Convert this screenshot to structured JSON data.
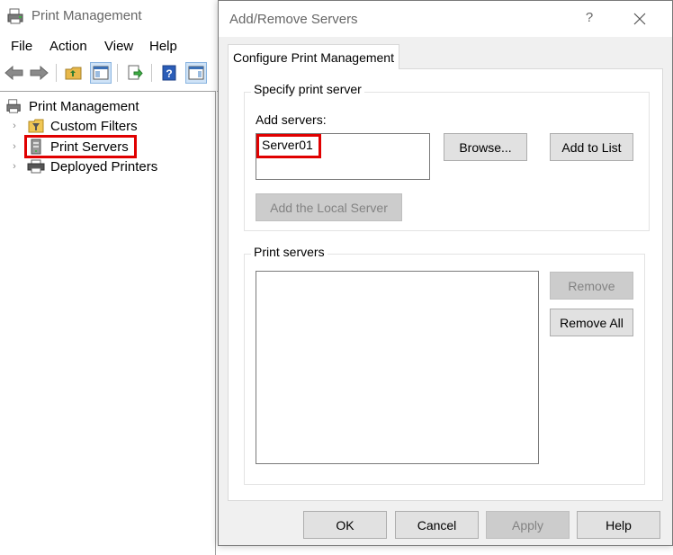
{
  "mmc": {
    "title": "Print Management",
    "menu": [
      "File",
      "Action",
      "View",
      "Help"
    ],
    "tree": {
      "root": "Print Management",
      "items": [
        {
          "label": "Custom Filters",
          "icon": "filter-folder-icon"
        },
        {
          "label": "Print Servers",
          "icon": "server-icon"
        },
        {
          "label": "Deployed Printers",
          "icon": "printer-icon"
        }
      ]
    }
  },
  "dialog": {
    "title": "Add/Remove Servers",
    "help_glyph": "?",
    "tab": "Configure Print Management",
    "specify_group": {
      "legend": "Specify print server",
      "add_servers_label": "Add servers:",
      "add_servers_value": "Server01",
      "browse_label": "Browse...",
      "add_to_list_label": "Add to List",
      "add_local_label": "Add the Local Server"
    },
    "servers_group": {
      "legend": "Print servers",
      "items": [],
      "remove_label": "Remove",
      "remove_all_label": "Remove All"
    },
    "footer": {
      "ok": "OK",
      "cancel": "Cancel",
      "apply": "Apply",
      "help": "Help"
    }
  },
  "colors": {
    "highlight": "#e00000",
    "disabled_text": "#838383",
    "button_face": "#e1e1e1"
  }
}
